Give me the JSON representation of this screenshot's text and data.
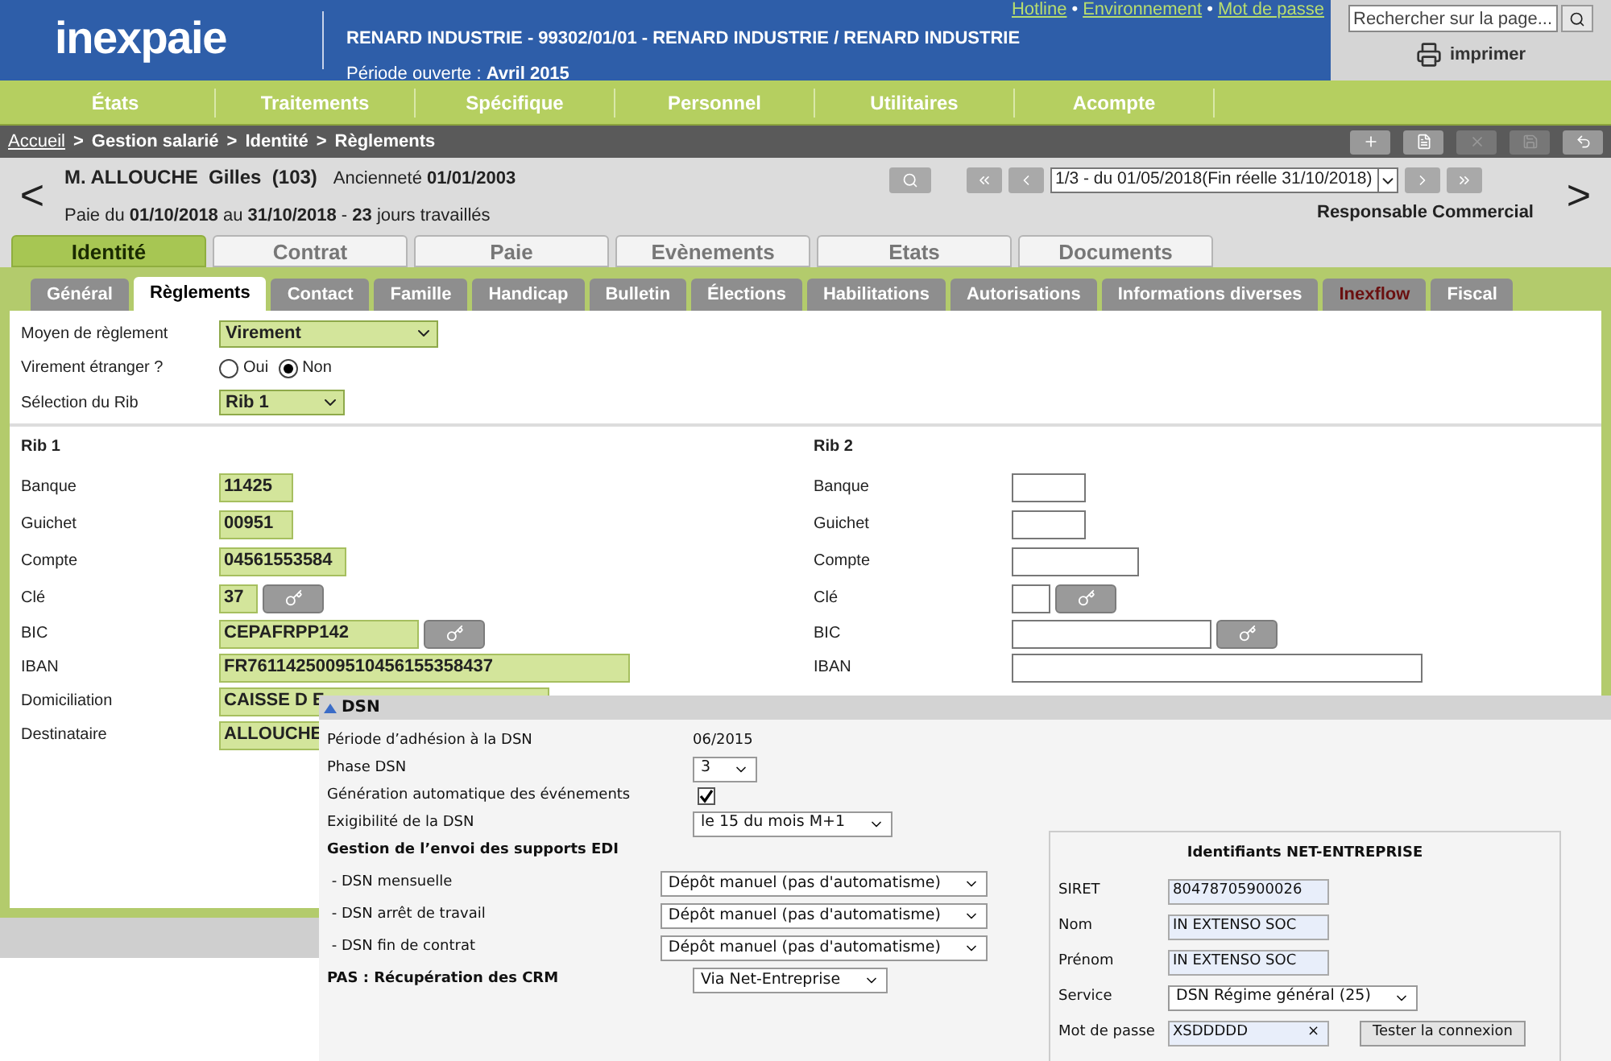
{
  "header": {
    "logo": "inexpaie",
    "company": "RENARD INDUSTRIE - 99302/01/01 - RENARD INDUSTRIE / RENARD INDUSTRIE",
    "period": "Période ouverte : **Avril 2015**",
    "links": [
      "Hotline",
      "Environnement",
      "Mot de passe"
    ],
    "link_separator": "•",
    "search": {
      "placeholder": "Rechercher sur la page..."
    },
    "print": "imprimer"
  },
  "menu": [
    "États",
    "Traitements",
    "Spécifique",
    "Personnel",
    "Utilitaires",
    "Acompte"
  ],
  "breadcrumb": {
    "separator": ">",
    "items": [
      {
        "label": "Accueil",
        "link": true
      },
      {
        "label": "Gestion salarié",
        "link": false
      },
      {
        "label": "Identité",
        "link": false
      },
      {
        "label": "Règlements",
        "link": false
      }
    ]
  },
  "employee": {
    "name": "M. ALLOUCHE  Gilles  (103)",
    "seniority": "Ancienneté **01/01/2003**",
    "pay_period": "Paie du **01/10/2018** au **31/10/2018** - **23** jours travaillés",
    "contract": "1/3 - du 01/05/2018(Fin réelle 31/10/2018)",
    "job": "Responsable Commercial",
    "prev": "<",
    "next": ">"
  },
  "tabs": [
    {
      "label": "Identité",
      "selected": true
    },
    {
      "label": "Contrat",
      "selected": false
    },
    {
      "label": "Paie",
      "selected": false
    },
    {
      "label": "Evènements",
      "selected": false
    },
    {
      "label": "Etats",
      "selected": false
    },
    {
      "label": "Documents",
      "selected": false
    }
  ],
  "subtabs": [
    {
      "label": "Général",
      "selected": false,
      "emphasis": false
    },
    {
      "label": "Règlements",
      "selected": true,
      "emphasis": false
    },
    {
      "label": "Contact",
      "selected": false,
      "emphasis": false
    },
    {
      "label": "Famille",
      "selected": false,
      "emphasis": false
    },
    {
      "label": "Handicap",
      "selected": false,
      "emphasis": false
    },
    {
      "label": "Bulletin",
      "selected": false,
      "emphasis": false
    },
    {
      "label": "Élections",
      "selected": false,
      "emphasis": false
    },
    {
      "label": "Habilitations",
      "selected": false,
      "emphasis": false
    },
    {
      "label": "Autorisations",
      "selected": false,
      "emphasis": false
    },
    {
      "label": "Informations diverses",
      "selected": false,
      "emphasis": false
    },
    {
      "label": "Inexflow",
      "selected": false,
      "emphasis": true
    },
    {
      "label": "Fiscal",
      "selected": false,
      "emphasis": false
    }
  ],
  "payment": {
    "method": {
      "label": "Moyen de règlement",
      "value": "Virement"
    },
    "foreign": {
      "label": "Virement étranger ?",
      "options": [
        {
          "label": "Oui",
          "selected": false
        },
        {
          "label": "Non",
          "selected": true
        }
      ]
    },
    "rib_select": {
      "label": "Sélection du Rib",
      "value": "Rib 1"
    }
  },
  "ribs": [
    {
      "title": "Rib 1",
      "fields": [
        {
          "kind": "text",
          "label": "Banque",
          "value": "11425"
        },
        {
          "kind": "text",
          "label": "Guichet",
          "value": "00951"
        },
        {
          "kind": "text",
          "label": "Compte",
          "value": "04561553584"
        },
        {
          "kind": "lookup",
          "label": "Clé",
          "value": "37"
        },
        {
          "kind": "lookup",
          "label": "BIC",
          "value": "CEPAFRPP142"
        },
        {
          "kind": "text",
          "label": "IBAN",
          "value": "FR7611425009510456155358437"
        },
        {
          "kind": "text",
          "label": "Domiciliation",
          "value": "CAISSE D E"
        },
        {
          "kind": "text",
          "label": "Destinataire",
          "value": "ALLOUCHE"
        }
      ]
    },
    {
      "title": "Rib 2",
      "fields": [
        {
          "kind": "text",
          "label": "Banque"
        },
        {
          "kind": "text",
          "label": "Guichet"
        },
        {
          "kind": "text",
          "label": "Compte"
        },
        {
          "kind": "lookup",
          "label": "Clé"
        },
        {
          "kind": "lookup",
          "label": "BIC"
        },
        {
          "kind": "text",
          "label": "IBAN"
        }
      ]
    }
  ],
  "dsn": {
    "title": "DSN",
    "expanded": true,
    "rows": [
      {
        "kind": "text",
        "label": "Période d’adhésion à la DSN",
        "value": "06/2015",
        "bold": false
      },
      {
        "kind": "select",
        "label": "Phase DSN",
        "value": "3",
        "bold": false
      },
      {
        "kind": "checkbox",
        "label": "Génération automatique des événements",
        "checked": true,
        "bold": false
      },
      {
        "kind": "select",
        "label": "Exigibilité de la DSN",
        "value": "le 15 du mois M+1",
        "bold": false
      },
      {
        "kind": "heading",
        "label": "Gestion de l’envoi des supports EDI",
        "bold": true
      },
      {
        "kind": "select",
        "label": " - DSN mensuelle",
        "value": "Dépôt manuel (pas d'automatisme)",
        "bold": false
      },
      {
        "kind": "select",
        "label": " - DSN arrêt de travail",
        "value": "Dépôt manuel (pas d'automatisme)",
        "bold": false
      },
      {
        "kind": "select",
        "label": " - DSN fin de contrat",
        "value": "Dépôt manuel (pas d'automatisme)",
        "bold": false
      },
      {
        "kind": "select",
        "label": "PAS : Récupération des CRM",
        "value": "Via Net-Entreprise",
        "bold": true
      }
    ],
    "net": {
      "title": "Identifiants NET-ENTREPRISE",
      "fields": [
        {
          "kind": "input",
          "label": "SIRET",
          "value": "80478705900026"
        },
        {
          "kind": "input",
          "label": "Nom",
          "value": "IN EXTENSO SOC"
        },
        {
          "kind": "input",
          "label": "Prénom",
          "value": "IN EXTENSO SOC"
        },
        {
          "kind": "select",
          "label": "Service",
          "value": "DSN Régime général (25)"
        },
        {
          "kind": "password",
          "label": "Mot de passe",
          "value": "XSDDDDD",
          "clear": "×"
        }
      ],
      "button": "Tester la connexion"
    }
  }
}
